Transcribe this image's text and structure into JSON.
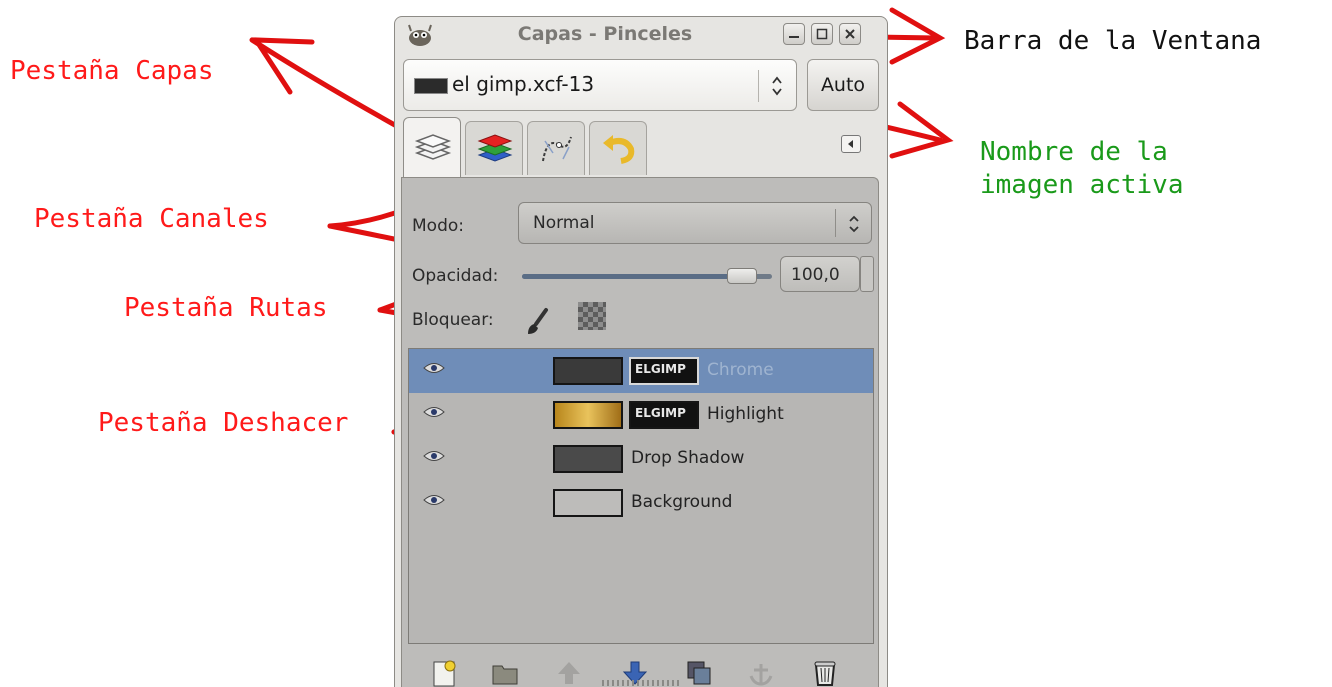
{
  "annotations": {
    "pestana_capas": "Pestaña Capas",
    "barra_ventana": "Barra de la Ventana",
    "nombre_imagen": "Nombre de la\nimagen activa",
    "pestana_canales": "Pestaña Canales",
    "pestana_rutas": "Pestaña Rutas",
    "pestana_deshacer": "Pestaña Deshacer"
  },
  "window": {
    "title": "Capas - Pinceles",
    "image_name": "el gimp.xcf-13",
    "auto_label": "Auto"
  },
  "tabs": [
    {
      "name": "layers-icon"
    },
    {
      "name": "channels-icon"
    },
    {
      "name": "paths-icon"
    },
    {
      "name": "undo-icon"
    }
  ],
  "controls": {
    "mode_label": "Modo:",
    "mode_value": "Normal",
    "opacity_label": "Opacidad:",
    "opacity_value": "100,0",
    "opacity_fraction": 1.0,
    "lock_label": "Bloquear:"
  },
  "layers": [
    {
      "name": "Chrome",
      "selected": true,
      "mask_text": "ELGIMP",
      "visible": true
    },
    {
      "name": "Highlight",
      "selected": false,
      "mask_text": "ELGIMP",
      "visible": true
    },
    {
      "name": "Drop Shadow",
      "selected": false,
      "visible": true
    },
    {
      "name": "Background",
      "selected": false,
      "visible": true
    }
  ],
  "toolbar": {
    "icons": [
      "new-layer-icon",
      "new-group-icon",
      "raise-layer-icon",
      "lower-layer-icon",
      "duplicate-layer-icon",
      "anchor-layer-icon",
      "delete-layer-icon"
    ]
  },
  "colors": {
    "annotation_red": "#ff1a1a",
    "annotation_green": "#1a9a1a",
    "selection_blue": "#6f8db8"
  }
}
